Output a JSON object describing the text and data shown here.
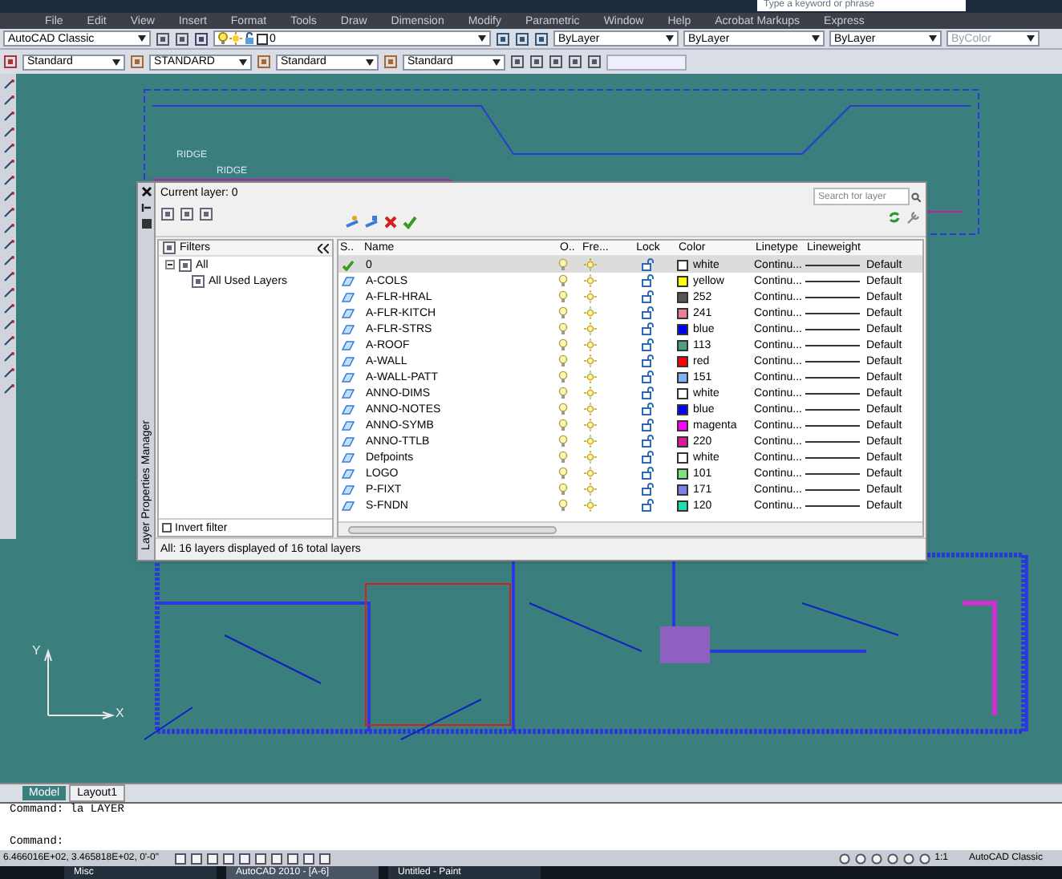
{
  "title_bar": {
    "search_placeholder": "Type a keyword or phrase"
  },
  "menu": [
    "File",
    "Edit",
    "View",
    "Insert",
    "Format",
    "Tools",
    "Draw",
    "Dimension",
    "Modify",
    "Parametric",
    "Window",
    "Help",
    "Acrobat Markups",
    "Express"
  ],
  "toolbar_1": {
    "workspace": "AutoCAD Classic",
    "layer": "0",
    "color_setting": "ByLayer",
    "linetype": "ByLayer",
    "lineweight": "ByLayer",
    "plot_style": "ByColor"
  },
  "toolbar_2": {
    "text_style": "Standard",
    "dim_style": "STANDARD",
    "table_style": "Standard",
    "multileader_style": "Standard"
  },
  "drawing": {
    "labels": [
      "RIDGE",
      "RIDGE"
    ],
    "ucs_labels": [
      "Y",
      "X"
    ]
  },
  "layer_manager": {
    "side_title": "Layer Properties Manager",
    "current_layer": "Current layer: 0",
    "search": {
      "placeholder": "Search for layer"
    },
    "filters": {
      "header": "Filters",
      "tree": [
        {
          "label": "All",
          "expanded": true,
          "children": [
            {
              "label": "All Used Layers"
            }
          ]
        }
      ]
    },
    "invert_filter": {
      "label": "Invert filter",
      "checked": false
    },
    "columns": [
      "S..",
      "Name",
      "O..",
      "Fre...",
      "Lock",
      "Color",
      "Linetype",
      "Lineweight"
    ],
    "layers": [
      {
        "name": "0",
        "current": true,
        "selected": true,
        "color_name": "white",
        "color": "#ffffff",
        "linetype": "Continu...",
        "lineweight": "Default"
      },
      {
        "name": "A-COLS",
        "current": false,
        "selected": false,
        "color_name": "yellow",
        "color": "#ffff00",
        "linetype": "Continu...",
        "lineweight": "Default"
      },
      {
        "name": "A-FLR-HRAL",
        "current": false,
        "selected": false,
        "color_name": "252",
        "color": "#555555",
        "linetype": "Continu...",
        "lineweight": "Default"
      },
      {
        "name": "A-FLR-KITCH",
        "current": false,
        "selected": false,
        "color_name": "241",
        "color": "#e87f96",
        "linetype": "Continu...",
        "lineweight": "Default"
      },
      {
        "name": "A-FLR-STRS",
        "current": false,
        "selected": false,
        "color_name": "blue",
        "color": "#0000ff",
        "linetype": "Continu...",
        "lineweight": "Default"
      },
      {
        "name": "A-ROOF",
        "current": false,
        "selected": false,
        "color_name": "113",
        "color": "#4f9f7a",
        "linetype": "Continu...",
        "lineweight": "Default"
      },
      {
        "name": "A-WALL",
        "current": false,
        "selected": false,
        "color_name": "red",
        "color": "#ff0000",
        "linetype": "Continu...",
        "lineweight": "Default"
      },
      {
        "name": "A-WALL-PATT",
        "current": false,
        "selected": false,
        "color_name": "151",
        "color": "#7fb2f0",
        "linetype": "Continu...",
        "lineweight": "Default"
      },
      {
        "name": "ANNO-DIMS",
        "current": false,
        "selected": false,
        "color_name": "white",
        "color": "#ffffff",
        "linetype": "Continu...",
        "lineweight": "Default"
      },
      {
        "name": "ANNO-NOTES",
        "current": false,
        "selected": false,
        "color_name": "blue",
        "color": "#0000ff",
        "linetype": "Continu...",
        "lineweight": "Default"
      },
      {
        "name": "ANNO-SYMB",
        "current": false,
        "selected": false,
        "color_name": "magenta",
        "color": "#ff00ff",
        "linetype": "Continu...",
        "lineweight": "Default"
      },
      {
        "name": "ANNO-TTLB",
        "current": false,
        "selected": false,
        "color_name": "220",
        "color": "#e0189a",
        "linetype": "Continu...",
        "lineweight": "Default"
      },
      {
        "name": "Defpoints",
        "current": false,
        "selected": false,
        "color_name": "white",
        "color": "#ffffff",
        "linetype": "Continu...",
        "lineweight": "Default"
      },
      {
        "name": "LOGO",
        "current": false,
        "selected": false,
        "color_name": "101",
        "color": "#7fe07f",
        "linetype": "Continu...",
        "lineweight": "Default"
      },
      {
        "name": "P-FIXT",
        "current": false,
        "selected": false,
        "color_name": "171",
        "color": "#7f7fe8",
        "linetype": "Continu...",
        "lineweight": "Default"
      },
      {
        "name": "S-FNDN",
        "current": false,
        "selected": false,
        "color_name": "120",
        "color": "#18e0b0",
        "linetype": "Continu...",
        "lineweight": "Default"
      }
    ],
    "status": "All: 16 layers displayed of 16 total layers"
  },
  "layout_tabs": [
    {
      "label": "Model",
      "selected": true
    },
    {
      "label": "Layout1",
      "selected": false
    }
  ],
  "command_lines": [
    "Command: la LAYER",
    "Command:"
  ],
  "status_bar": {
    "coordinates": "6.466016E+02, 3.465818E+02, 0'-0\"",
    "scale": "1:1",
    "workspace": "AutoCAD Classic"
  },
  "taskbar": [
    {
      "label": "Misc",
      "active": false
    },
    {
      "label": "AutoCAD 2010 - [A-6]",
      "active": true
    },
    {
      "label": "Untitled - Paint",
      "active": false
    }
  ]
}
